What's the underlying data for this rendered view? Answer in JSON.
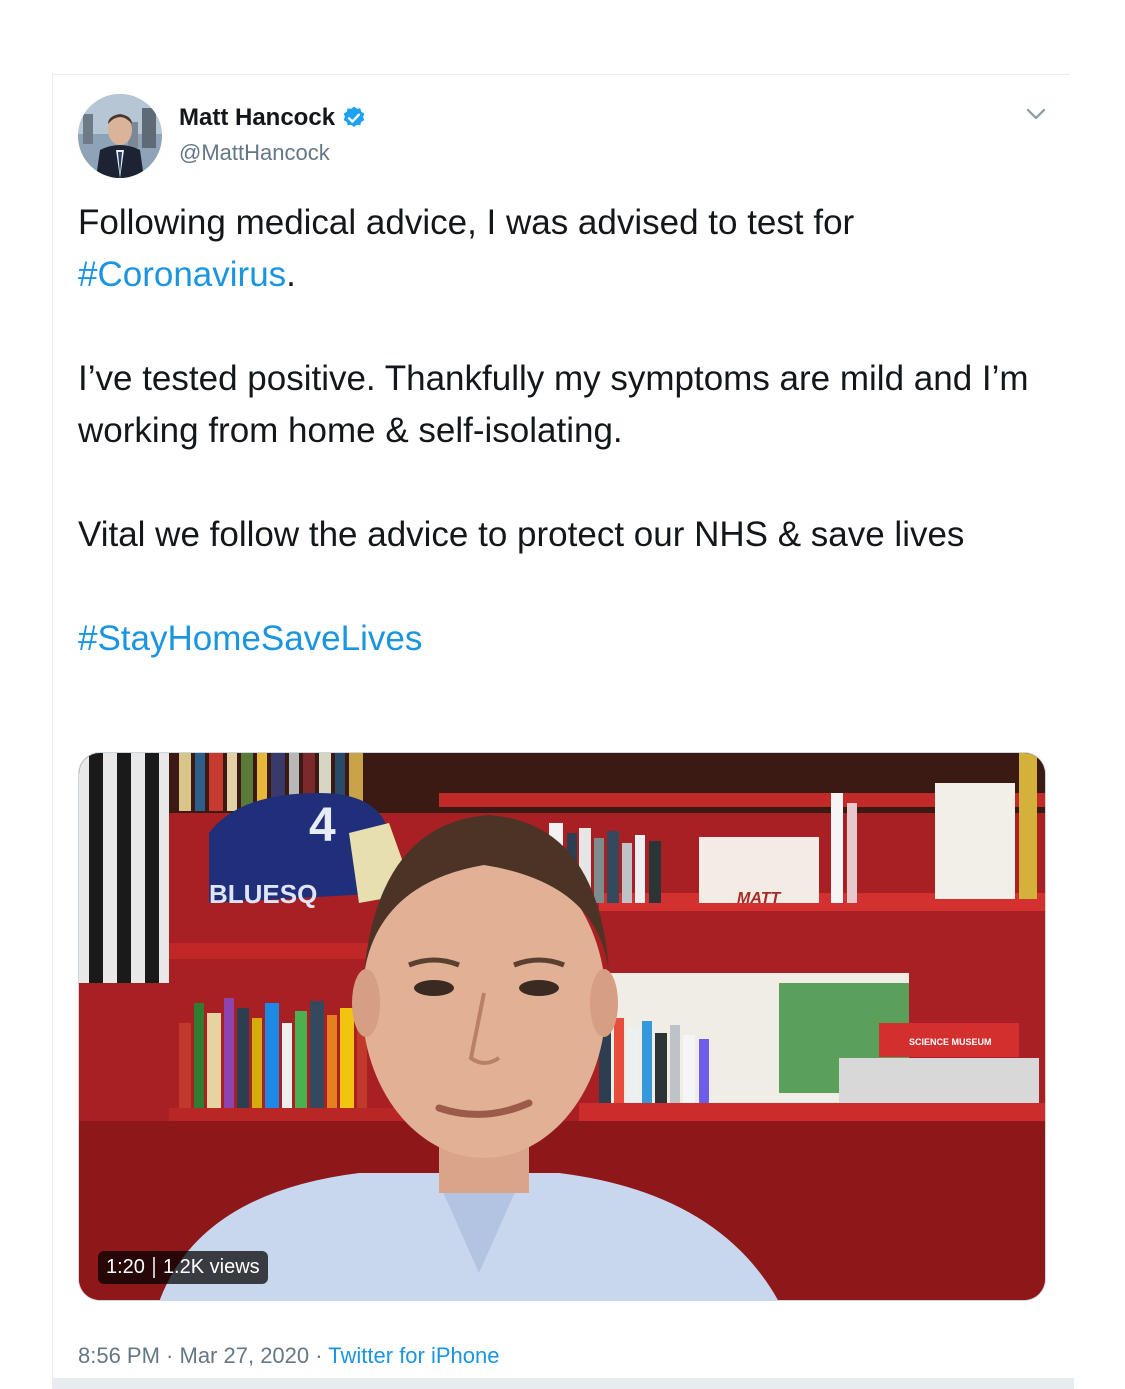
{
  "author": {
    "display_name": "Matt Hancock",
    "handle": "@MattHancock",
    "verified": true,
    "avatar_icon": "profile-photo"
  },
  "tweet": {
    "line1": "Following medical advice, I was advised to test for",
    "hashtag1": "#Coronavirus",
    "after_hashtag1": ".",
    "paragraph2": "I’ve tested positive. Thankfully my symptoms are mild and I’m working from home & self-isolating.",
    "paragraph3": "Vital we follow the advice to protect our NHS & save lives",
    "hashtag2": "#StayHomeSaveLives"
  },
  "video": {
    "duration": "1:20",
    "views": "1.2K views",
    "thumbnail_text": {
      "cap_text": "BLUESQ",
      "cap_number": "4",
      "mug_text": "MATT",
      "box_text": "SCIENCE MUSEUM"
    }
  },
  "meta": {
    "time": "8:56 PM",
    "separator": " · ",
    "date": "Mar 27, 2020",
    "source": "Twitter for iPhone"
  },
  "colors": {
    "link": "#1b95e0",
    "text": "#14171a",
    "secondary": "#657786",
    "verified": "#1da1f2"
  }
}
